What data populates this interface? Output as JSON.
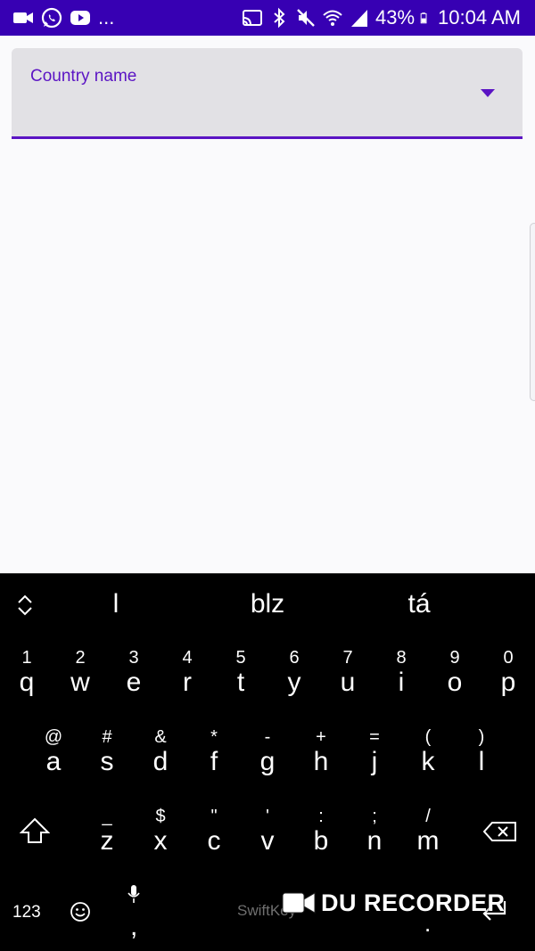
{
  "status_bar": {
    "overflow": "...",
    "battery_percent": "43%",
    "time": "10:04 AM",
    "icons_left": [
      "video-camera-icon",
      "whatsapp-icon",
      "youtube-icon"
    ],
    "icons_right": [
      "cast-icon",
      "bluetooth-icon",
      "mute-icon",
      "wifi-icon",
      "signal-icon",
      "battery-icon"
    ],
    "background": "#3700b3"
  },
  "dropdown": {
    "label": "Country name",
    "accent": "#5b14c4",
    "fill": "#e2e1e5"
  },
  "keyboard": {
    "suggestions": [
      "l",
      "blz",
      "tá"
    ],
    "row1": [
      {
        "hint": "1",
        "key": "q"
      },
      {
        "hint": "2",
        "key": "w"
      },
      {
        "hint": "3",
        "key": "e"
      },
      {
        "hint": "4",
        "key": "r"
      },
      {
        "hint": "5",
        "key": "t"
      },
      {
        "hint": "6",
        "key": "y"
      },
      {
        "hint": "7",
        "key": "u"
      },
      {
        "hint": "8",
        "key": "i"
      },
      {
        "hint": "9",
        "key": "o"
      },
      {
        "hint": "0",
        "key": "p"
      }
    ],
    "row2": [
      {
        "hint": "@",
        "key": "a"
      },
      {
        "hint": "#",
        "key": "s"
      },
      {
        "hint": "&",
        "key": "d"
      },
      {
        "hint": "*",
        "key": "f"
      },
      {
        "hint": "-",
        "key": "g"
      },
      {
        "hint": "+",
        "key": "h"
      },
      {
        "hint": "=",
        "key": "j"
      },
      {
        "hint": "(",
        "key": "k"
      },
      {
        "hint": ")",
        "key": "l"
      }
    ],
    "row3": [
      {
        "hint": "_",
        "key": "z"
      },
      {
        "hint": "$",
        "key": "x"
      },
      {
        "hint": "\"",
        "key": "c"
      },
      {
        "hint": "'",
        "key": "v"
      },
      {
        "hint": ":",
        "key": "b"
      },
      {
        "hint": ";",
        "key": "n"
      },
      {
        "hint": "/",
        "key": "m"
      }
    ],
    "num_key": "123",
    "comma": ",",
    "period": ".",
    "brand": "SwiftKey"
  },
  "watermark": {
    "text": "DU RECORDER"
  }
}
